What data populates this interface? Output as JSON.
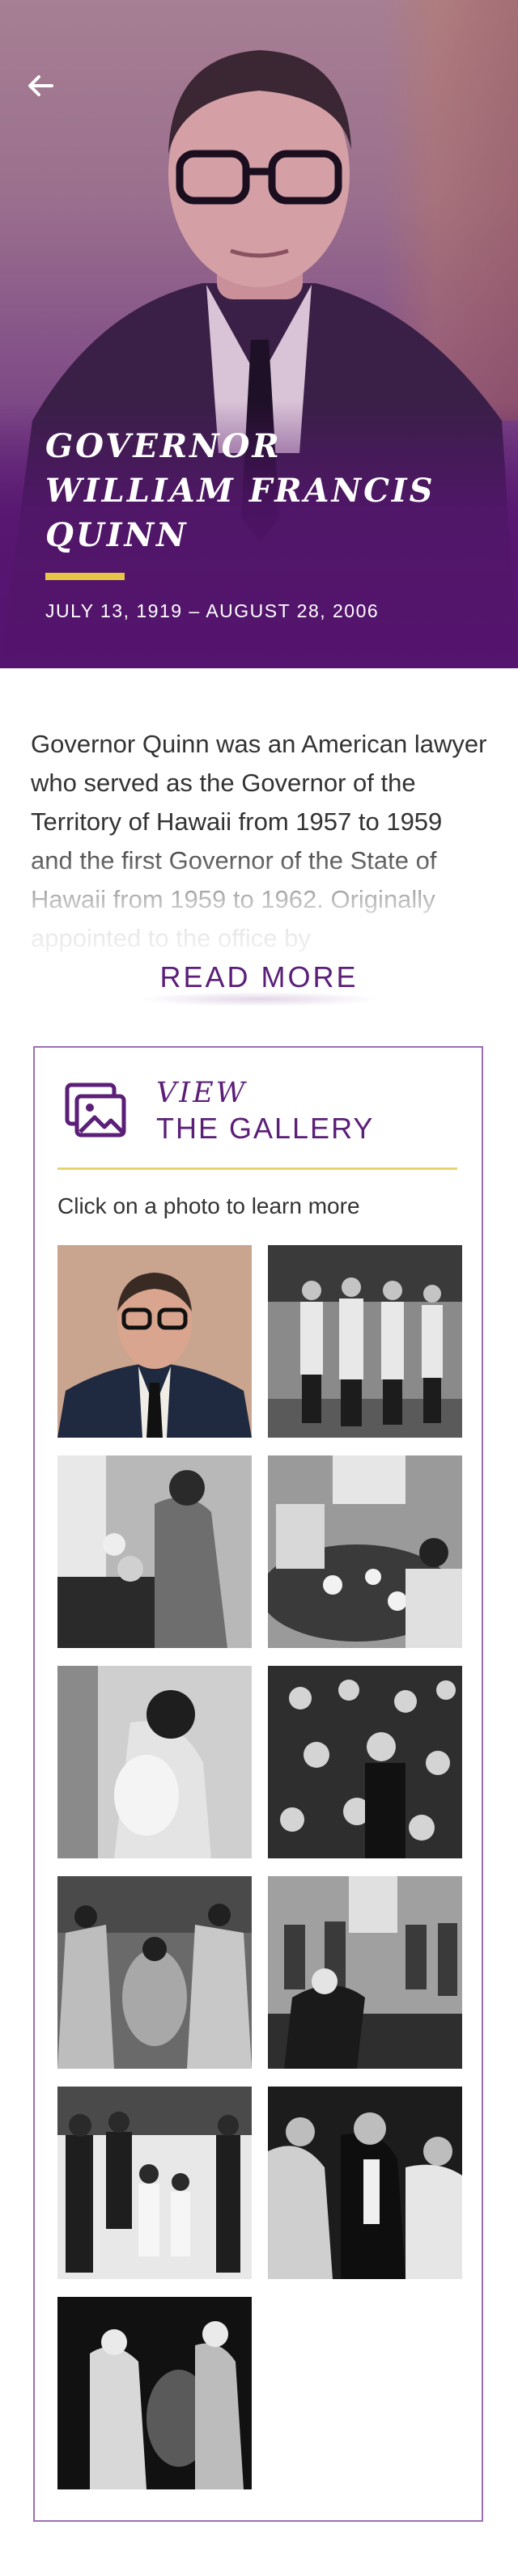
{
  "hero": {
    "back_icon": "arrow-left-icon",
    "title_line1": "GOVERNOR",
    "title_line2": "WILLIAM FRANCIS",
    "title_line3": "QUINN",
    "dates": "JULY 13, 1919 – AUGUST 28, 2006",
    "accent_color": "#e8c547"
  },
  "bio": {
    "text": "Governor Quinn was an American lawyer who served as the Governor of the Territory of Hawaii from 1957 to 1959 and the first Governor of the State of Hawaii from 1959 to 1962. Originally appointed to the office by",
    "read_more_label": "READ MORE"
  },
  "gallery": {
    "icon": "photo-gallery-icon",
    "heading_italic": "VIEW",
    "heading": "THE GALLERY",
    "hint": "Click on a photo to learn more",
    "brand_color": "#5b1f78",
    "photo_count": 11
  }
}
